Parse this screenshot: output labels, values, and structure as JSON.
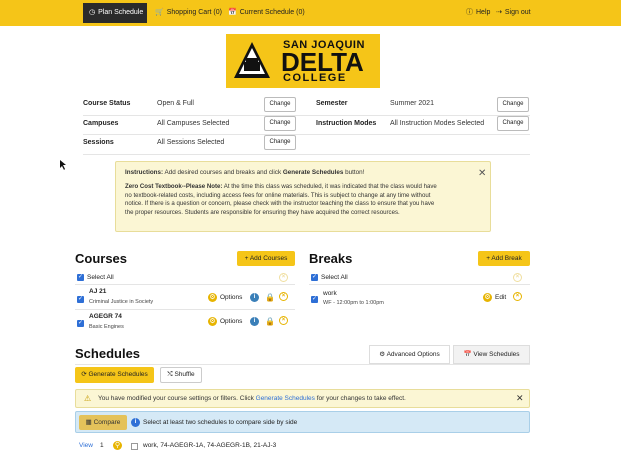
{
  "nav": {
    "plan_schedule": "Plan Schedule",
    "shopping_cart": "Shopping Cart (0)",
    "current_schedule": "Current Schedule (0)",
    "help": "Help",
    "sign_out": "Sign out"
  },
  "logo": {
    "line1": "SAN JOAQUIN",
    "line2": "DELTA",
    "line3": "COLLEGE"
  },
  "settings": {
    "course_status": {
      "label": "Course Status",
      "value": "Open & Full",
      "button": "Change"
    },
    "campuses": {
      "label": "Campuses",
      "value": "All Campuses Selected",
      "button": "Change"
    },
    "sessions": {
      "label": "Sessions",
      "value": "All Sessions Selected",
      "button": "Change"
    },
    "semester": {
      "label": "Semester",
      "value": "Summer 2021",
      "button": "Change"
    },
    "instruction_modes": {
      "label": "Instruction Modes",
      "value": "All Instruction Modes Selected",
      "button": "Change"
    }
  },
  "notice": {
    "instructions_label": "Instructions:",
    "instructions_text": " Add desired courses and breaks and click ",
    "instructions_strong": "Generate Schedules",
    "instructions_end": " button!",
    "textbook_label": "Zero Cost Textbook--Please Note:",
    "textbook_text": " At the time this class was scheduled, it was indicated that the class would have no textbook-related costs, including access fees for online materials. This is subject to change at any time without notice. If there is a question or concern, please check with the instructor teaching the class to ensure that you have the proper resources. Students are responsible for ensuring they have acquired the correct resources."
  },
  "courses": {
    "title": "Courses",
    "add_button": "+ Add Courses",
    "select_all": "Select All",
    "items": [
      {
        "code": "AJ 21",
        "name": "Criminal Justice in Society",
        "options": "Options"
      },
      {
        "code": "AGEGR 74",
        "name": "Basic Engines",
        "options": "Options"
      }
    ]
  },
  "breaks": {
    "title": "Breaks",
    "add_button": "+ Add Break",
    "select_all": "Select All",
    "items": [
      {
        "name": "work",
        "detail": "WF - 12:00pm to 1:00pm",
        "edit": "Edit"
      }
    ]
  },
  "schedules": {
    "title": "Schedules",
    "advanced_options": "Advanced Options",
    "view_schedules": "View Schedules",
    "generate": "Generate Schedules",
    "shuffle": "Shuffle",
    "warning_pre": "You have modified your course settings or filters. Click ",
    "warning_link": "Generate Schedules",
    "warning_post": " for your changes to take effect.",
    "compare_button": "Compare",
    "compare_text": "Select at least two schedules to compare side by side",
    "row_view": "View",
    "row_number": "1",
    "row_text": "work, 74-AGEGR-1A, 74-AGEGR-1B, 21-AJ-3"
  },
  "colors": {
    "brand_yellow": "#f5c518",
    "nav_active": "#2b2b2b",
    "link_blue": "#2e6fd6"
  }
}
